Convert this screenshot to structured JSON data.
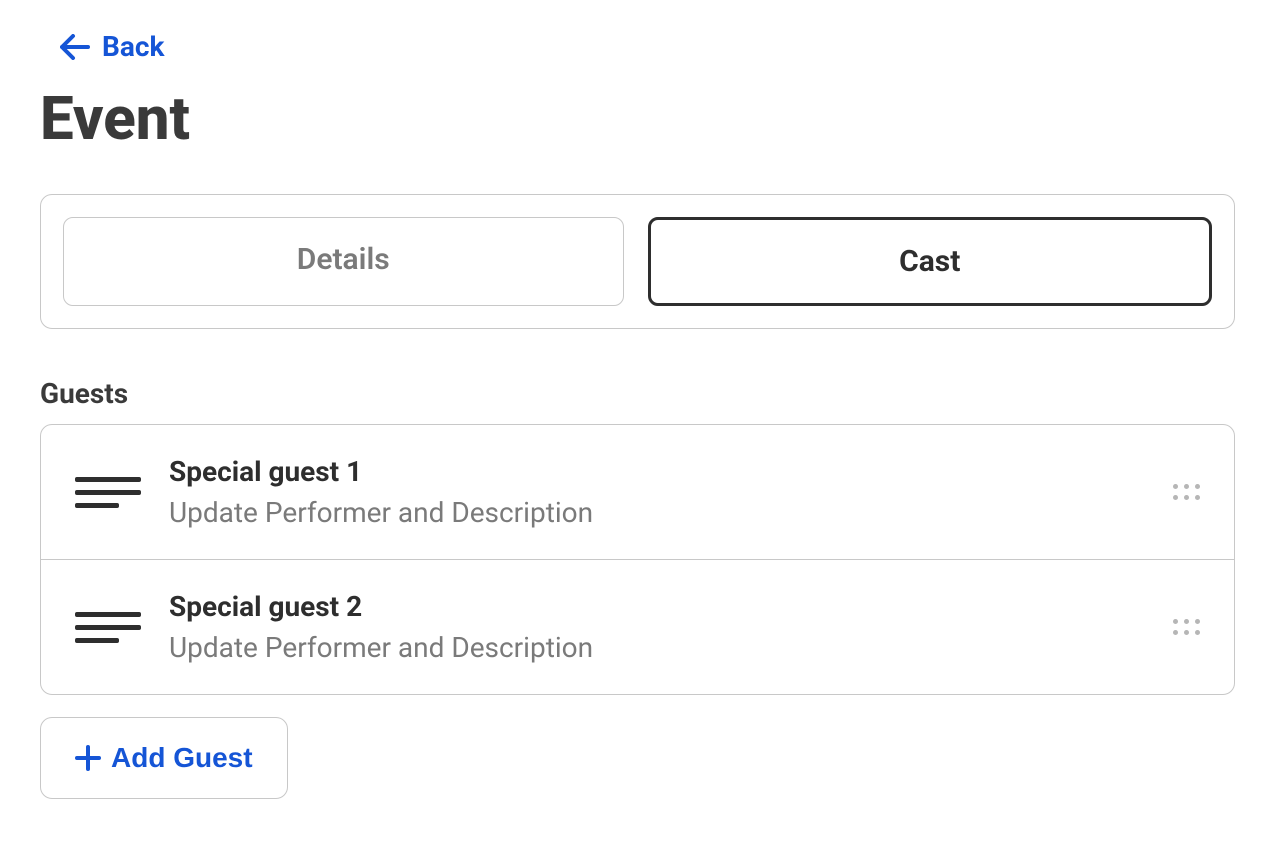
{
  "back": {
    "label": "Back"
  },
  "page_title": "Event",
  "tabs": [
    {
      "label": "Details",
      "active": false
    },
    {
      "label": "Cast",
      "active": true
    }
  ],
  "guests_section": {
    "heading": "Guests"
  },
  "guests": [
    {
      "title": "Special guest 1",
      "subtitle": "Update Performer and Description"
    },
    {
      "title": "Special guest 2",
      "subtitle": "Update Performer and Description"
    }
  ],
  "add_guest": {
    "label": "Add Guest"
  },
  "colors": {
    "accent": "#1555D6",
    "text_dark": "#3a3a3a",
    "text_muted": "#7a7a7a",
    "border": "#c8c8c8"
  }
}
